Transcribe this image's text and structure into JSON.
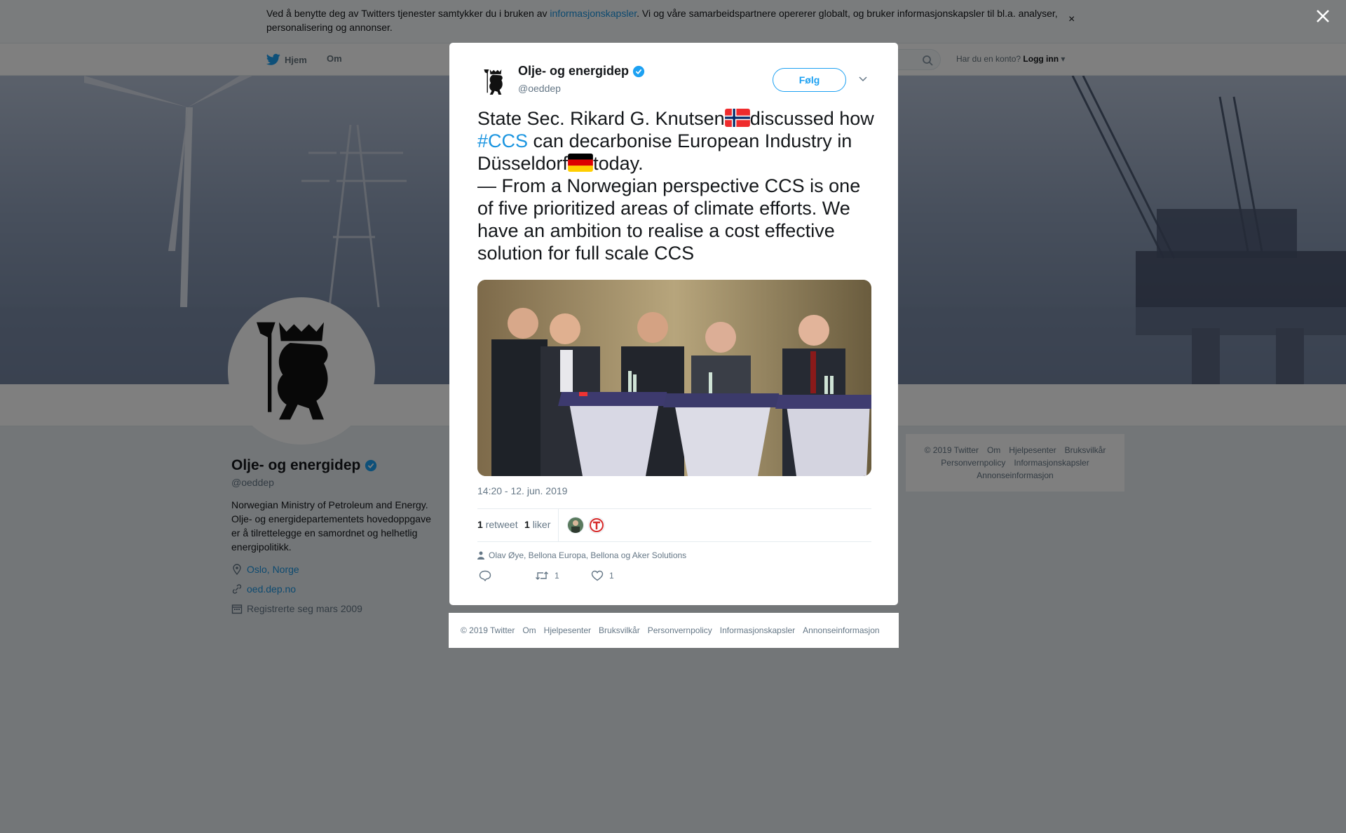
{
  "cookie_banner": {
    "text_before": "Ved å benytte deg av Twitters tjenester samtykker du i bruken av ",
    "link": "informasjonskapsler",
    "text_after": ". Vi og våre samarbeidspartnere opererer globalt, og bruker informasjonskapsler til bl.a. analyser, personalisering og annonser.",
    "close": "×"
  },
  "topnav": {
    "home": "Hjem",
    "about": "Om",
    "login_prompt": "Har du en konto?",
    "login": "Logg inn"
  },
  "profile": {
    "name": "Olje- og energidep",
    "handle": "@oeddep",
    "bio": "Norwegian Ministry of Petroleum and Energy. Olje- og energidepartementets hovedoppgave er å tilrettelegge en samordnet og helhetlig energipolitikk.",
    "location": "Oslo, Norge",
    "website": "oed.dep.no",
    "joined": "Registrerte seg mars 2009"
  },
  "side_footer": {
    "items": [
      "© 2019 Twitter",
      "Om",
      "Hjelpesenter",
      "Bruksvilkår",
      "Personvernpolicy",
      "Informasjonskapsler",
      "Annonseinformasjon"
    ]
  },
  "tweet": {
    "author_name": "Olje- og energidep",
    "author_handle": "@oeddep",
    "follow_label": "Følg",
    "text_1": "State Sec. Rikard G. Knutsen",
    "text_2": "discussed how ",
    "hashtag": "#CCS",
    "text_3": " can decarbonise European Industry in Düsseldorf",
    "text_4": "today.",
    "text_5": "— From a Norwegian perspective CCS is one of five prioritized areas of climate efforts. We have an ambition to realise a cost effective solution for full scale CCS",
    "timestamp": "14:20 - 12. jun. 2019",
    "retweet_count": "1",
    "retweet_label": "retweet",
    "like_count": "1",
    "like_label": "liker",
    "replying_to": "Olav Øye, Bellona Europa, Bellona og Aker Solutions",
    "action_retweets": "1",
    "action_likes": "1"
  },
  "modal_footer": {
    "items": [
      "© 2019 Twitter",
      "Om",
      "Hjelpesenter",
      "Bruksvilkår",
      "Personvernpolicy",
      "Informasjonskapsler",
      "Annonseinformasjon"
    ]
  },
  "colors": {
    "accent": "#1da1f2",
    "link": "#1b95e0",
    "muted": "#657786"
  },
  "icons": [
    "close-icon",
    "twitter-bird-icon",
    "search-icon",
    "verified-icon",
    "chevron-down-icon",
    "location-icon",
    "link-icon",
    "calendar-icon",
    "person-icon",
    "reply-icon",
    "retweet-icon",
    "heart-icon",
    "norway-flag-icon",
    "germany-flag-icon"
  ]
}
